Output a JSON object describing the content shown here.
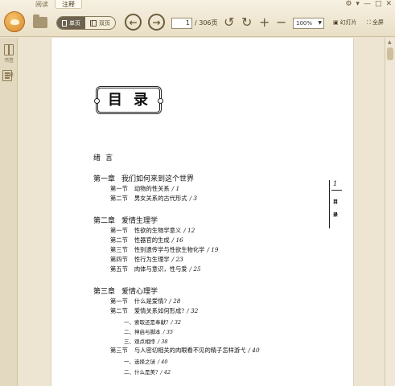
{
  "tabs": [
    {
      "label": "阅读",
      "active": false
    },
    {
      "label": "注释",
      "active": true
    }
  ],
  "window_controls": [
    "⚙",
    "▾",
    "—",
    "□",
    "✕"
  ],
  "toolbar": {
    "single_page_label": "单页",
    "double_page_label": "双页",
    "current_page": "1",
    "total_pages": "/ 306页",
    "zoom_value": "100%",
    "slideshow_label": "幻灯片",
    "fullscreen_label": "全屏"
  },
  "sidebar": {
    "bookmark_label": "书签",
    "toc_label": "目录"
  },
  "page": {
    "title": "目录",
    "intro": "绪言",
    "side_marker": {
      "number": "1",
      "chars": [
        "目",
        "录"
      ]
    },
    "chapters": [
      {
        "label": "第一章",
        "title": "我们如何来到这个世界"
      },
      {
        "label": "第二章",
        "title": "爱情生理学"
      },
      {
        "label": "第三章",
        "title": "爱情心理学"
      }
    ],
    "sections": [
      {
        "label": "第一节",
        "title": "动物的性关系",
        "page": "/ 1"
      },
      {
        "label": "第二节",
        "title": "男女关系的古代形式",
        "page": "/ 3"
      },
      {
        "label": "第一节",
        "title": "性欲的生物学意义",
        "page": "/ 12"
      },
      {
        "label": "第二节",
        "title": "性器官的生成",
        "page": "/ 16"
      },
      {
        "label": "第三节",
        "title": "性别遗传学与性欲生物化学",
        "page": "/ 19"
      },
      {
        "label": "第四节",
        "title": "性行为生理学",
        "page": "/ 23"
      },
      {
        "label": "第五节",
        "title": "肉体与意识，性与爱",
        "page": "/ 25"
      },
      {
        "label": "第一节",
        "title": "什么是爱情?",
        "page": "/ 28"
      },
      {
        "label": "第二节",
        "title": "爱情关系如何形成?",
        "page": "/ 32"
      },
      {
        "label": "第三节",
        "title": "与人密切相关的肉眼看不见的精子怎样游弋",
        "page": "/ 40"
      }
    ],
    "subsections": [
      {
        "title": "一、索取还是奉献?",
        "page": "/ 32"
      },
      {
        "title": "二、神启与脚本",
        "page": "/ 35"
      },
      {
        "title": "三、观点相悖",
        "page": "/ 38"
      },
      {
        "title": "一、选择之谜",
        "page": "/ 40"
      },
      {
        "title": "二、什么是美?",
        "page": "/ 42"
      }
    ]
  }
}
